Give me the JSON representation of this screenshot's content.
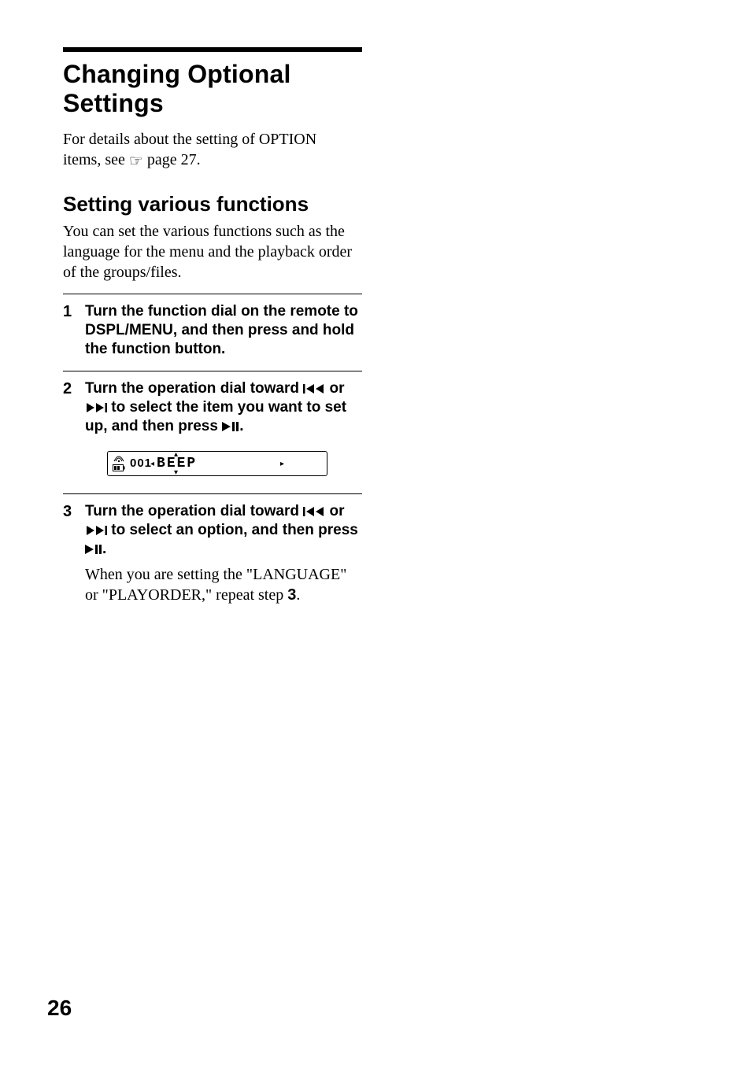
{
  "title": "Changing Optional Settings",
  "intro_line1": "For details about the setting of OPTION",
  "intro_line2_a": "items, see ",
  "intro_line2_b": " page 27.",
  "h2": "Setting various functions",
  "subintro": "You can set the various functions such as the language for the menu and the playback order of the groups/files.",
  "steps": {
    "s1": {
      "num": "1",
      "title": "Turn the function dial on the remote to DSPL/MENU, and then press and hold the function button."
    },
    "s2": {
      "num": "2",
      "title_a": "Turn the operation dial toward ",
      "title_b": " or ",
      "title_c": " to select the item you want to set up, and then press ",
      "title_d": "."
    },
    "s3": {
      "num": "3",
      "title_a": "Turn the operation dial toward ",
      "title_b": " or ",
      "title_c": " to select an option, and then press ",
      "title_d": ".",
      "note_a": "When you are setting the \"LANGUAGE\" or \"PLAYORDER,\" repeat step ",
      "note_b": "3",
      "note_c": "."
    }
  },
  "lcd": {
    "counter": "001",
    "text": "BEEP"
  },
  "page_number": "26"
}
